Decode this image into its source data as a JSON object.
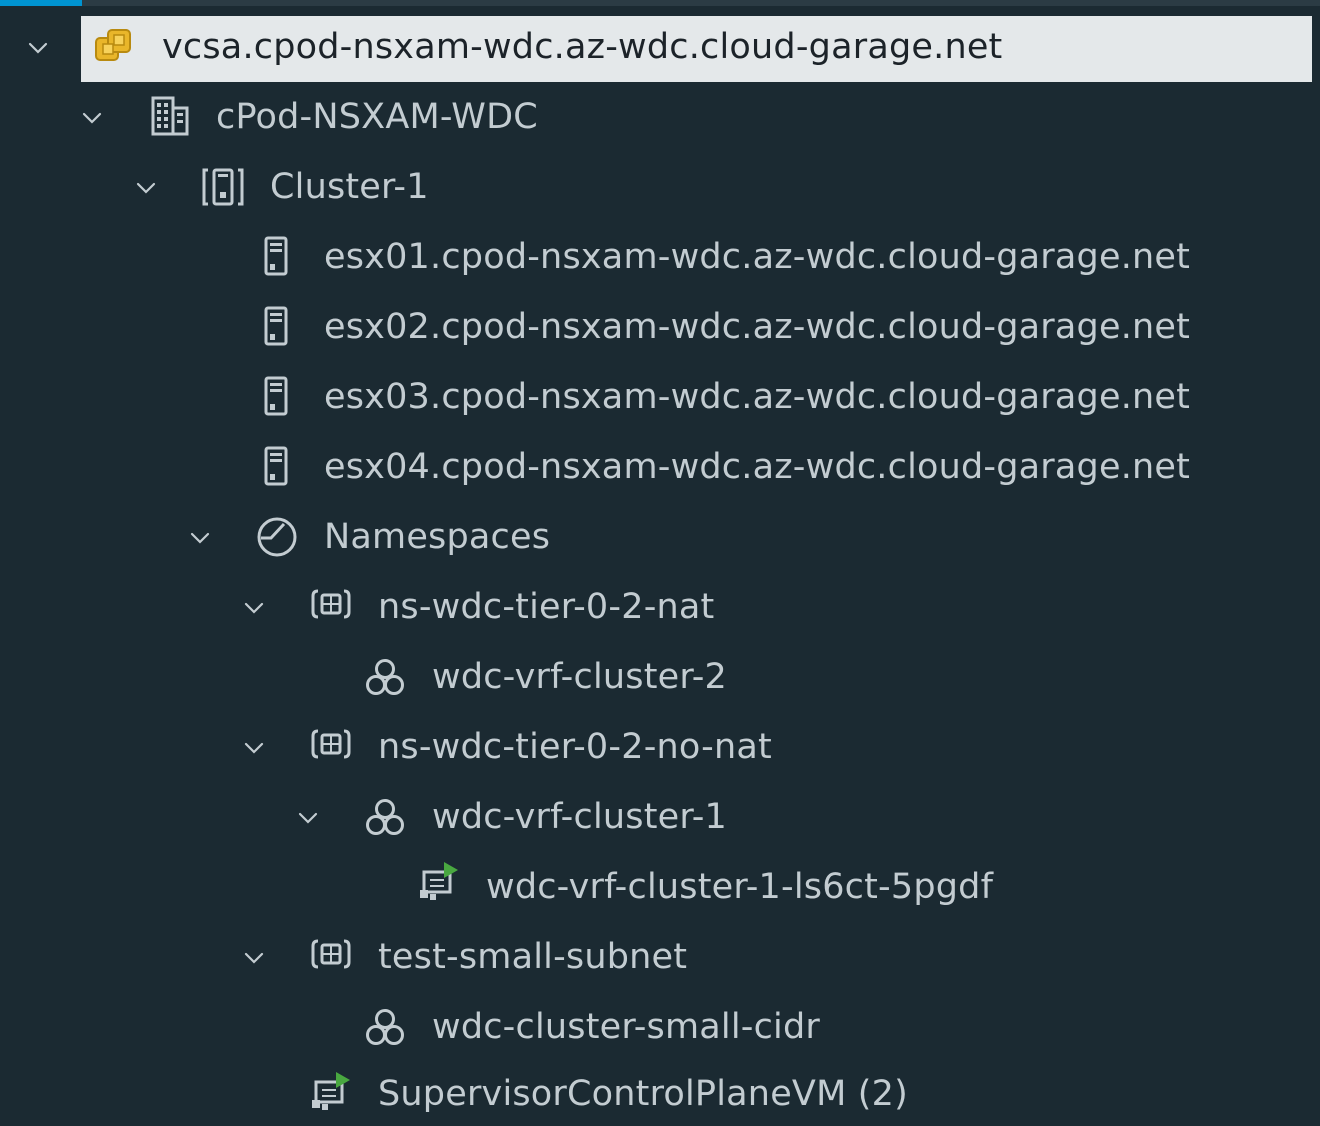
{
  "tree": {
    "root": {
      "label": "vcsa.cpod-nsxam-wdc.az-wdc.cloud-garage.net",
      "icon": "vcenter-icon"
    },
    "datacenter": {
      "label": "cPod-NSXAM-WDC",
      "icon": "datacenter-icon"
    },
    "cluster": {
      "label": "Cluster-1",
      "icon": "cluster-icon"
    },
    "hosts": [
      {
        "label": "esx01.cpod-nsxam-wdc.az-wdc.cloud-garage.net",
        "icon": "host-icon"
      },
      {
        "label": "esx02.cpod-nsxam-wdc.az-wdc.cloud-garage.net",
        "icon": "host-icon"
      },
      {
        "label": "esx03.cpod-nsxam-wdc.az-wdc.cloud-garage.net",
        "icon": "host-icon"
      },
      {
        "label": "esx04.cpod-nsxam-wdc.az-wdc.cloud-garage.net",
        "icon": "host-icon"
      }
    ],
    "namespaces": {
      "label": "Namespaces",
      "icon": "namespaces-icon",
      "items": [
        {
          "label": "ns-wdc-tier-0-2-nat",
          "icon": "namespace-icon"
        },
        {
          "label": "wdc-vrf-cluster-2",
          "icon": "tkg-cluster-icon"
        },
        {
          "label": "ns-wdc-tier-0-2-no-nat",
          "icon": "namespace-icon"
        },
        {
          "label": "wdc-vrf-cluster-1",
          "icon": "tkg-cluster-icon"
        },
        {
          "label": "wdc-vrf-cluster-1-ls6ct-5pgdf",
          "icon": "vm-running-icon"
        },
        {
          "label": "test-small-subnet",
          "icon": "namespace-icon"
        },
        {
          "label": "wdc-cluster-small-cidr",
          "icon": "tkg-cluster-icon"
        },
        {
          "label": "SupervisorControlPlaneVM (2)",
          "icon": "vm-running-icon"
        }
      ]
    }
  }
}
